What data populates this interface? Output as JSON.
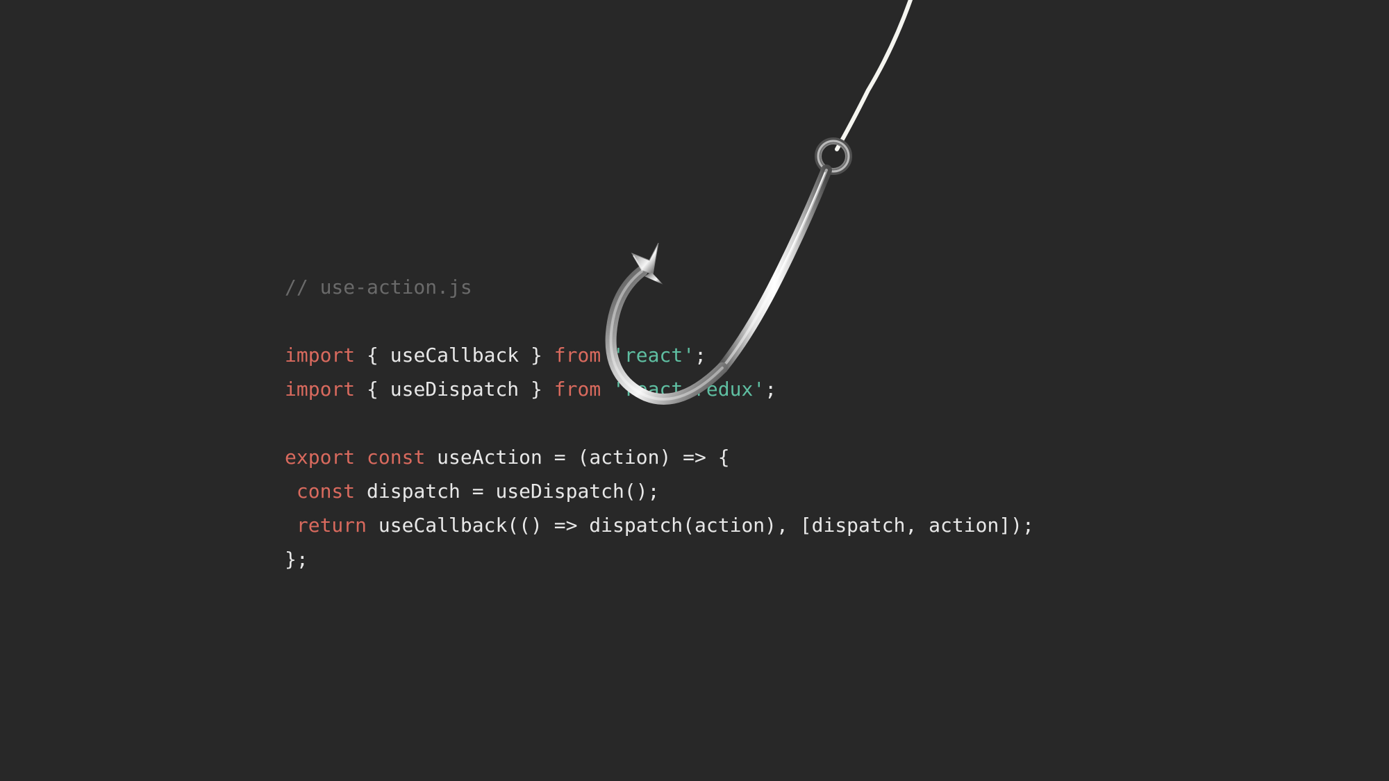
{
  "code": {
    "line1_comment": "// use-action.js",
    "line2_import": "import",
    "line2_brace_open": " { ",
    "line2_ident": "useCallback",
    "line2_brace_close": " } ",
    "line2_from": "from",
    "line2_space": " ",
    "line2_string": "'react'",
    "line2_semi": ";",
    "line3_import": "import",
    "line3_brace_open": " { ",
    "line3_ident": "useDispatch",
    "line3_brace_close": " } ",
    "line3_from": "from",
    "line3_space": " ",
    "line3_string": "'react-redux'",
    "line3_semi": ";",
    "line4_export": "export",
    "line4_space1": " ",
    "line4_const": "const",
    "line4_rest": " useAction = (action) => {",
    "line5_indent": " ",
    "line5_const": "const",
    "line5_rest": " dispatch = useDispatch();",
    "line6_indent": " ",
    "line6_return": "return",
    "line6_rest": " useCallback(() => dispatch(action), [dispatch, action]);",
    "line7": "};"
  }
}
